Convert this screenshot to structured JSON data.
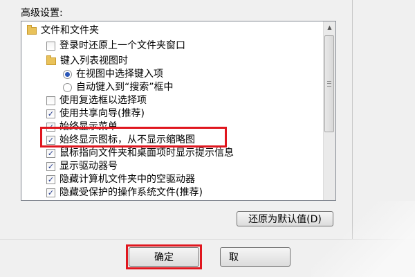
{
  "section_label": "高级设置:",
  "tree": {
    "items": [
      {
        "type": "folder",
        "label": "文件和文件夹"
      },
      {
        "type": "checkbox",
        "checked": false,
        "label": "登录时还原上一个文件夹窗口"
      },
      {
        "type": "folder",
        "label": "键入列表视图时"
      },
      {
        "type": "radio",
        "selected": true,
        "label": "在视图中选择键入项"
      },
      {
        "type": "radio",
        "selected": false,
        "label": "自动键入到“搜索”框中"
      },
      {
        "type": "checkbox",
        "checked": false,
        "label": "使用复选框以选择项"
      },
      {
        "type": "checkbox",
        "checked": true,
        "label": "使用共享向导(推荐)"
      },
      {
        "type": "checkbox",
        "checked": true,
        "label": "始终显示菜单"
      },
      {
        "type": "checkbox",
        "checked": true,
        "label": "始终显示图标，从不显示缩略图"
      },
      {
        "type": "checkbox",
        "checked": true,
        "label": "鼠标指向文件夹和桌面项时显示提示信息"
      },
      {
        "type": "checkbox",
        "checked": true,
        "label": "显示驱动器号"
      },
      {
        "type": "checkbox",
        "checked": true,
        "label": "隐藏计算机文件夹中的空驱动器"
      },
      {
        "type": "checkbox",
        "checked": true,
        "label": "隐藏受保护的操作系统文件(推荐)"
      }
    ]
  },
  "buttons": {
    "restore_defaults": "还原为默认值(D)",
    "ok": "确定",
    "cancel": "取"
  },
  "colors": {
    "highlight": "#e0161e",
    "check": "#21398d"
  }
}
